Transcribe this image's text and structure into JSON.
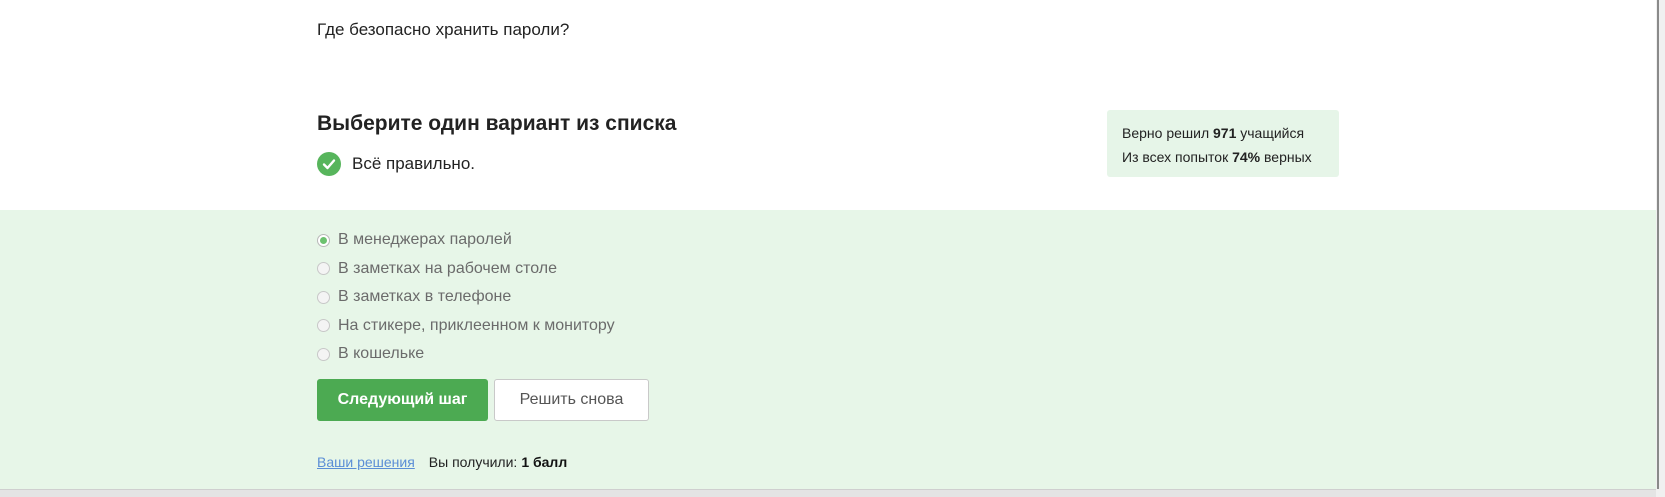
{
  "question": {
    "text": "Где безопасно хранить пароли?"
  },
  "task": {
    "heading": "Выберите один вариант из списка",
    "result_text": "Всё правильно.",
    "result_icon": "check-circle-icon",
    "result_color": "#57b55c"
  },
  "stats": {
    "solved_prefix": "Верно решил",
    "solved_count": "971",
    "solved_suffix": "учащийся",
    "attempts_prefix": "Из всех попыток",
    "attempts_percent": "74%",
    "attempts_suffix": "верных",
    "background_color": "#e6f5e8"
  },
  "options": [
    {
      "label": "В менеджерах паролей",
      "selected": true
    },
    {
      "label": "В заметках на рабочем столе",
      "selected": false
    },
    {
      "label": "В заметках в телефоне",
      "selected": false
    },
    {
      "label": "На стикере, приклеенном к монитору",
      "selected": false
    },
    {
      "label": "В кошельке",
      "selected": false
    }
  ],
  "buttons": {
    "next_label": "Следующий шаг",
    "retry_label": "Решить снова"
  },
  "footer": {
    "solutions_link": "Ваши решения",
    "score_prefix": "Вы получили:",
    "score_value": "1 балл"
  },
  "colors": {
    "accent": "#4caa52",
    "panel_background": "#e7f6e8",
    "link": "#5b8ed6"
  }
}
